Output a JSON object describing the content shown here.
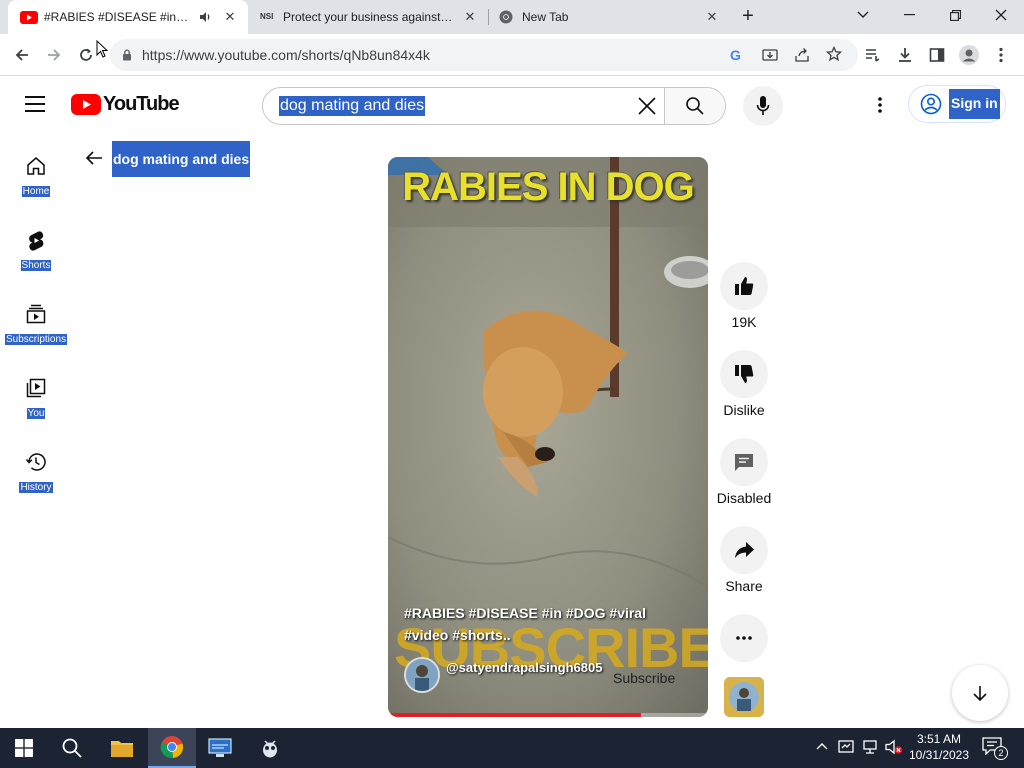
{
  "browser": {
    "tabs": [
      {
        "title": "#RABIES #DISEASE #in #DOG"
      },
      {
        "title": "Protect your business against ne"
      },
      {
        "title": "New Tab"
      }
    ],
    "url": "https://www.youtube.com/shorts/qNb8un84x4k"
  },
  "youtube": {
    "logo_text": "YouTube",
    "search_value": "dog mating and dies",
    "signin_label": "Sign in",
    "sidebar": [
      {
        "label": "Home",
        "icon": "home-icon"
      },
      {
        "label": "Shorts",
        "icon": "shorts-icon"
      },
      {
        "label": "Subscriptions",
        "icon": "subscriptions-icon"
      },
      {
        "label": "You",
        "icon": "library-icon"
      },
      {
        "label": "History",
        "icon": "history-icon"
      }
    ],
    "query_label": "dog mating and dies"
  },
  "short": {
    "overlay_title": "RABIES IN DOG",
    "watermark": "SUBSCRIBE",
    "caption": "#RABIES #DISEASE #in #DOG #viral #video #shorts..",
    "channel": "@satyendrapalsingh6805",
    "subscribe_label": "Subscribe",
    "progress_fraction": 0.79
  },
  "actions": {
    "like_count": "19K",
    "dislike_label": "Dislike",
    "comments_label": "Disabled",
    "share_label": "Share"
  },
  "taskbar": {
    "time": "3:51 AM",
    "date": "10/31/2023",
    "notification_count": "2"
  },
  "colors": {
    "youtube_red": "#ff0000",
    "selection_blue": "#2f63c8",
    "taskbar": "#1c2433"
  }
}
